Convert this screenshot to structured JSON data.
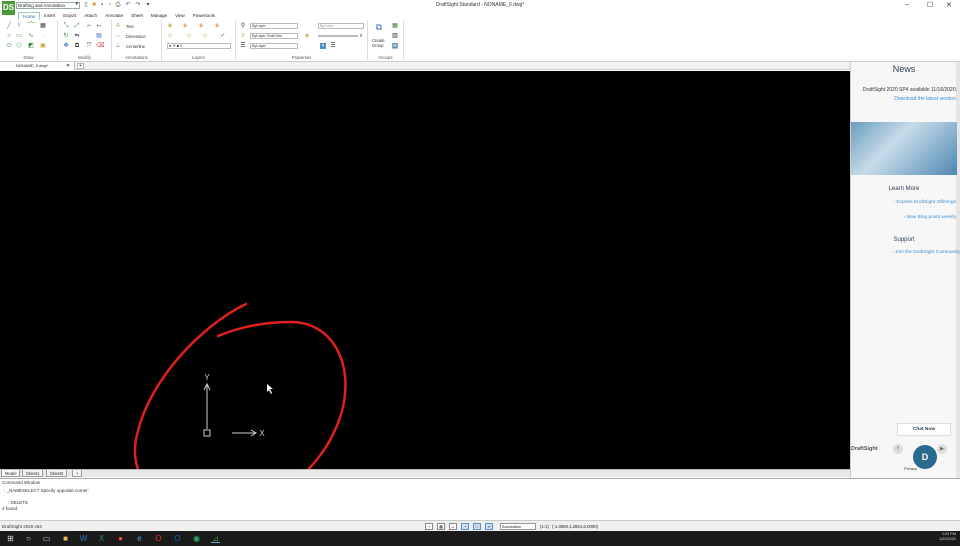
{
  "app": {
    "logo": "DS",
    "workspace": "Drafting and Annotation",
    "window_title": "DraftSight Standard - NONAME_0.dwg*",
    "minimize": "–",
    "maximize": "☐",
    "close": "✕"
  },
  "ribbon": {
    "tabs": [
      "Home",
      "Insert",
      "Export",
      "Attach",
      "Annotate",
      "Sheet",
      "Manage",
      "View",
      "Powertools"
    ],
    "groups": [
      "Draw",
      "Modify",
      "Annotations",
      "Layers",
      "Properties",
      "Groups"
    ],
    "annotations": {
      "text": "Text",
      "dimension": "Dimension",
      "centerline": "Centerline"
    },
    "layer_value": "0",
    "properties": {
      "color": "ByLayer",
      "linestyle": "ByLayer",
      "linestyle_sub": "Solid line",
      "lineweight": "ByLayer",
      "transparency": "ByColor",
      "transparency_value": "0"
    },
    "groups_create": "Create Group"
  },
  "document": {
    "tab": "NONAME_0.dwg*",
    "tab_close": "✕",
    "new_tab": "+"
  },
  "canvas": {
    "ucs_y": "Y",
    "ucs_x": "X"
  },
  "sheets": [
    "Model",
    "Sheet1",
    "Sheet2"
  ],
  "sheet_add": "+",
  "command": {
    "title": "Command Window",
    "line1": ": _NAMESELECT Specify opposite corner:",
    "line2": ": DELETE",
    "line3": "4 found"
  },
  "status": {
    "version": "DraftSight 2020 x64",
    "annotation": "Annotation",
    "scale": "(1:1)",
    "coords": "(-1.0550,1.2821,0.0000)"
  },
  "news": {
    "title": "News",
    "text_prefix": "DraftSight 2020 SP4 available 11/16/2020.",
    "link": "Download the latest version.",
    "learn_more": "Learn More",
    "link1": "Explore DraftSight Offerings",
    "link2": "New Blog posts weekly",
    "support": "Support",
    "link3": "Join the DraftSight Community",
    "chat": "Chat Now",
    "brand": "DraftSight",
    "privacy": "Privacy"
  },
  "taskbar": {
    "time": "1:24 PM",
    "date": "1/23/2021"
  }
}
